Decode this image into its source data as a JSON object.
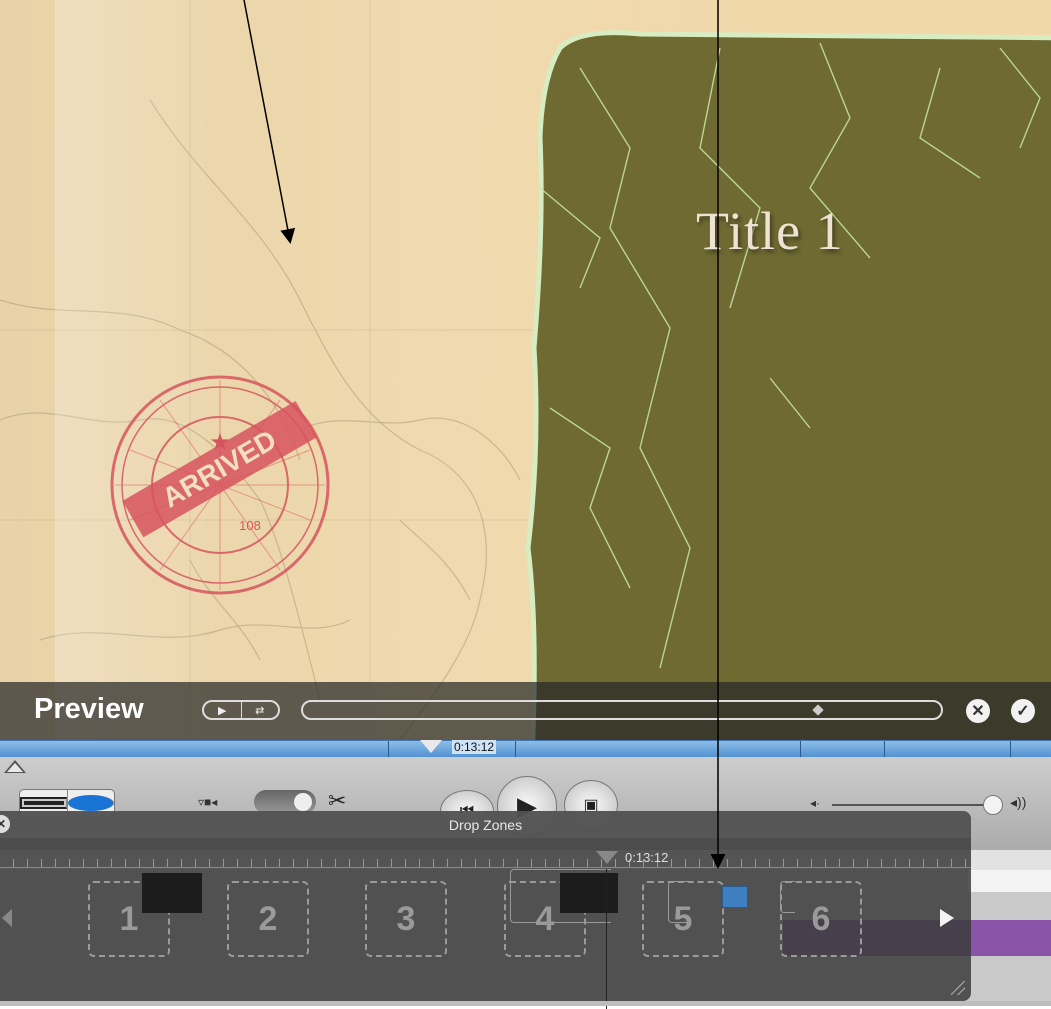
{
  "preview": {
    "slide_title": "Title 1",
    "stamp_text": "ARRIVED",
    "stamp_number": "108",
    "label": "Preview",
    "play_icon": "play-icon",
    "loop_icon": "loop-icon",
    "cancel_icon": "close-circle-icon",
    "apply_icon": "checkmark-circle-icon"
  },
  "timeline": {
    "timecode": "0:13:12"
  },
  "toolbar": {
    "clip_view_icon": "filmstrip-icon",
    "time_view_icon": "clock-icon",
    "camera_icon": "camera-icon",
    "scissors_icon": "scissors-icon",
    "rewind_icon": "rewind-icon",
    "play_icon": "play-icon",
    "fullscreen_icon": "fullscreen-play-icon",
    "volume_low_icon": "speaker-low-icon",
    "volume_high_icon": "speaker-high-icon",
    "volume_level": 0.95
  },
  "drop_zones": {
    "title": "Drop Zones",
    "timecode": "0:13:12",
    "zones": [
      "1",
      "2",
      "3",
      "4",
      "5",
      "6"
    ]
  },
  "colors": {
    "panel_olive": "#6e6a32",
    "parchment": "#efd8ab",
    "stamp_red": "#d7545e",
    "timeline_blue": "#4f8fd0",
    "clip_purple": "#8a54a8"
  }
}
